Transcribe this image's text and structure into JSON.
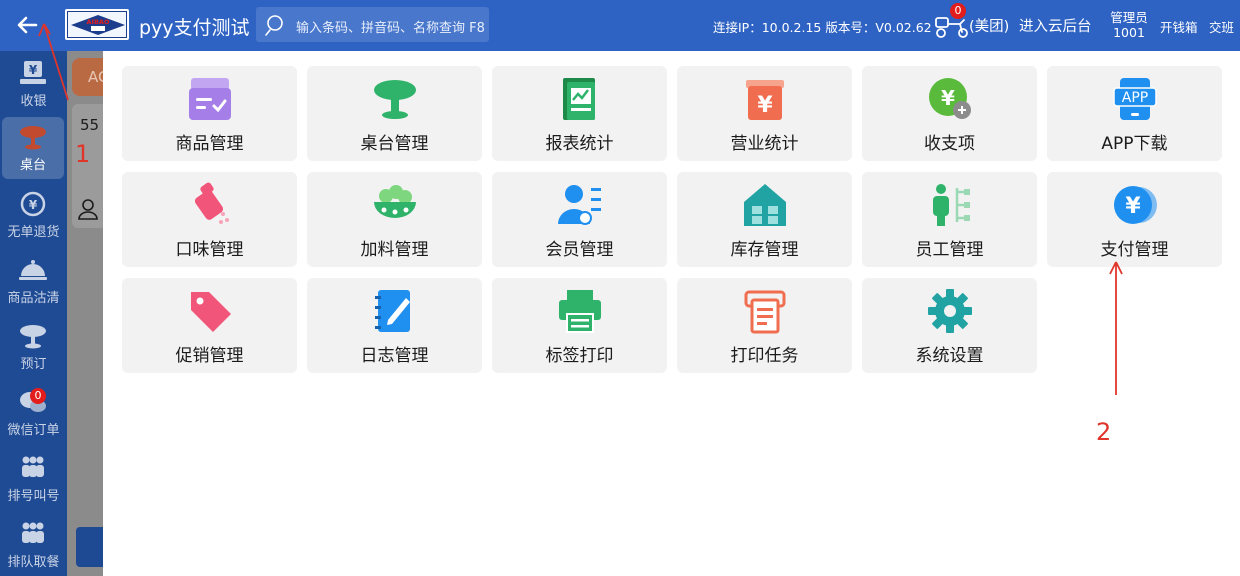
{
  "topbar": {
    "title": "pyy支付测试",
    "logo_text": "AIBAO",
    "search_placeholder": "输入条码、拼音码、名称查询 F8",
    "connection": "连接IP：10.0.2.15  版本号：V0.02.62",
    "delivery_badge": "0",
    "meituan": "(美团)",
    "cloud_backend": "进入云后台",
    "admin_role": "管理员",
    "admin_id": "1001",
    "cash_drawer": "开钱箱",
    "handover": "交班"
  },
  "sidebar": {
    "items": [
      {
        "label": "收银",
        "icon": "cashier-yen-icon"
      },
      {
        "label": "桌台",
        "icon": "table-icon"
      },
      {
        "label": "无单退货",
        "icon": "return-yen-icon"
      },
      {
        "label": "商品沽清",
        "icon": "cloche-icon"
      },
      {
        "label": "预订",
        "icon": "reservation-icon"
      },
      {
        "label": "微信订单",
        "icon": "wechat-icon",
        "badge": "0"
      },
      {
        "label": "排号叫号",
        "icon": "queue-people-icon"
      },
      {
        "label": "排队取餐",
        "icon": "queue-pickup-icon"
      }
    ]
  },
  "background": {
    "tag": "AC",
    "number": "55"
  },
  "tiles": [
    {
      "label": "商品管理",
      "icon": "product-management-icon",
      "color": "#a57ee8"
    },
    {
      "label": "桌台管理",
      "icon": "table-management-icon",
      "color": "#2fb36a"
    },
    {
      "label": "报表统计",
      "icon": "report-statistics-icon",
      "color": "#29a35a"
    },
    {
      "label": "营业统计",
      "icon": "business-statistics-icon",
      "color": "#f06d4f"
    },
    {
      "label": "收支项",
      "icon": "income-expense-icon",
      "color": "#5aba3b"
    },
    {
      "label": "APP下载",
      "icon": "app-download-icon",
      "color": "#1f8ff0"
    },
    {
      "label": "口味管理",
      "icon": "flavor-management-icon",
      "color": "#f1557a"
    },
    {
      "label": "加料管理",
      "icon": "topping-management-icon",
      "color": "#2fb36a"
    },
    {
      "label": "会员管理",
      "icon": "member-management-icon",
      "color": "#1f8ff0"
    },
    {
      "label": "库存管理",
      "icon": "inventory-management-icon",
      "color": "#22a3a3"
    },
    {
      "label": "员工管理",
      "icon": "staff-management-icon",
      "color": "#2fb36a"
    },
    {
      "label": "支付管理",
      "icon": "payment-management-icon",
      "color": "#1f8ff0"
    },
    {
      "label": "促销管理",
      "icon": "promotion-management-icon",
      "color": "#f1557a"
    },
    {
      "label": "日志管理",
      "icon": "log-management-icon",
      "color": "#1f8ff0"
    },
    {
      "label": "标签打印",
      "icon": "label-print-icon",
      "color": "#2fb36a"
    },
    {
      "label": "打印任务",
      "icon": "print-task-icon",
      "color": "#f06d4f"
    },
    {
      "label": "系统设置",
      "icon": "system-settings-icon",
      "color": "#22a3a3"
    }
  ],
  "annotations": {
    "step1": "1",
    "step2": "2"
  }
}
